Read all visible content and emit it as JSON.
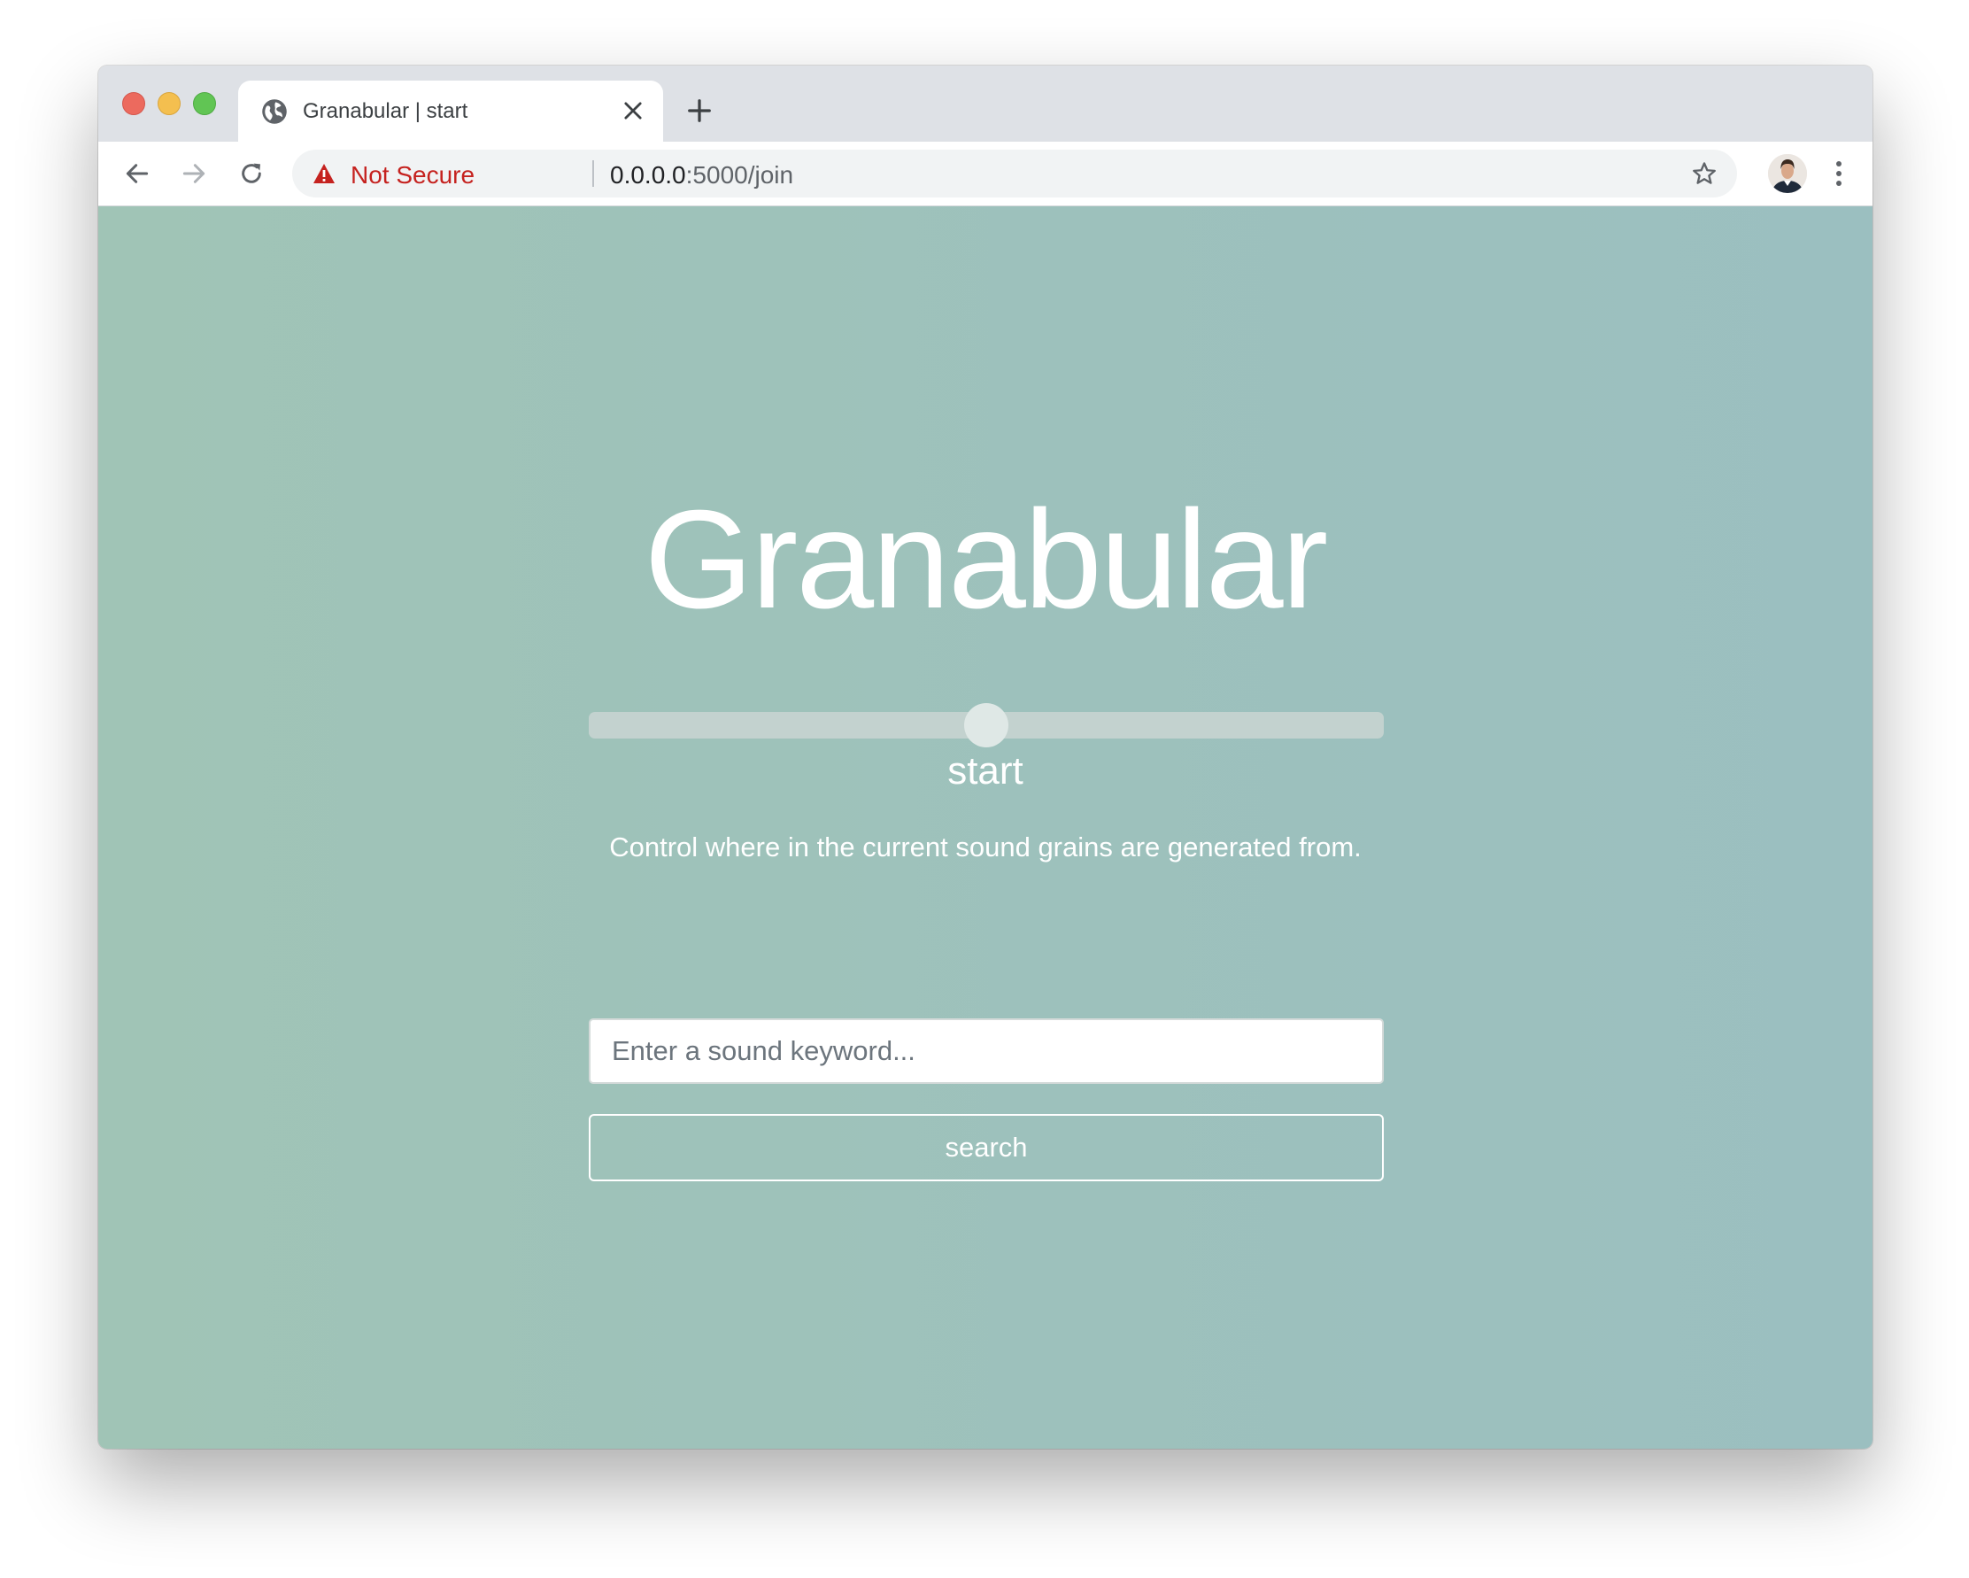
{
  "browser": {
    "tab": {
      "title": "Granabular | start",
      "icon": "globe-icon"
    },
    "new_tab_icon": "plus-icon",
    "address_bar": {
      "security_label": "Not Secure",
      "security_icon": "warning-triangle-icon",
      "url_host": "0.0.0.0",
      "url_rest": ":5000/join",
      "bookmark_icon": "star-icon"
    },
    "nav_icons": [
      "back-arrow-icon",
      "forward-arrow-icon",
      "reload-icon"
    ],
    "menu_icon": "vertical-dots-icon",
    "colors": {
      "tab_strip": "#dee1e6",
      "not_secure": "#c5221f"
    }
  },
  "page": {
    "title": "Granabular",
    "slider": {
      "label": "start",
      "value_fraction": 0.5
    },
    "description": "Control where in the current sound grains are generated from.",
    "search": {
      "placeholder": "Enter a sound keyword...",
      "value": "",
      "button_label": "search"
    },
    "colors": {
      "background_start": "#a0c4b6",
      "background_end": "#9bbfc0",
      "text": "#ffffff"
    }
  }
}
